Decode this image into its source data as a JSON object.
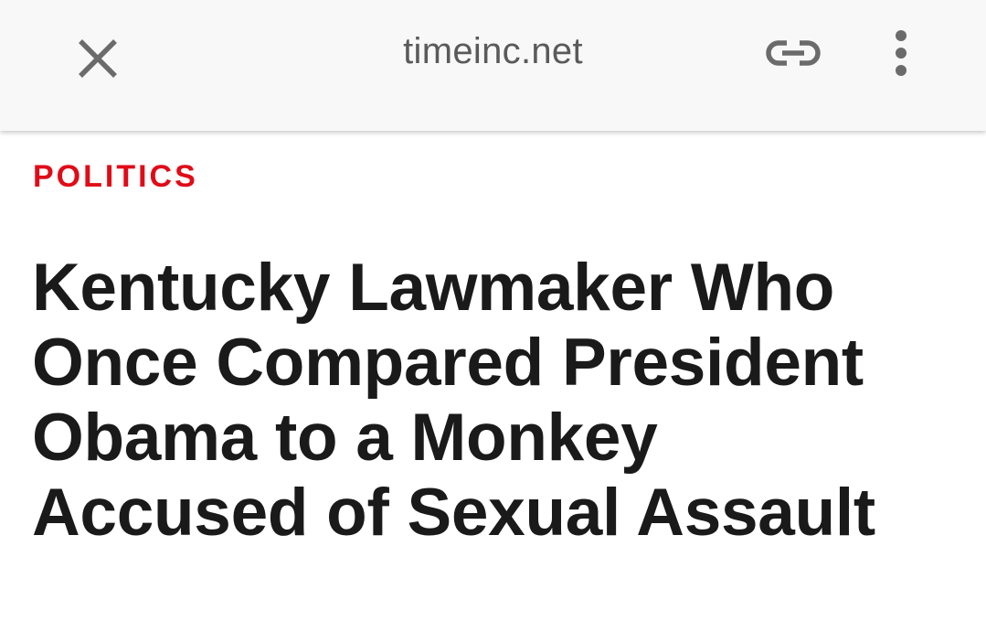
{
  "toolbar": {
    "url": "timeinc.net",
    "close_icon": "close-icon",
    "link_icon": "link-icon",
    "menu_icon": "more-vert-icon"
  },
  "article": {
    "category": "POLITICS",
    "category_color": "#e00b17",
    "headline_lines": [
      "Kentucky Lawmaker Who",
      "Once Compared President",
      "Obama to a Monkey",
      "Accused of Sexual Assault"
    ]
  }
}
